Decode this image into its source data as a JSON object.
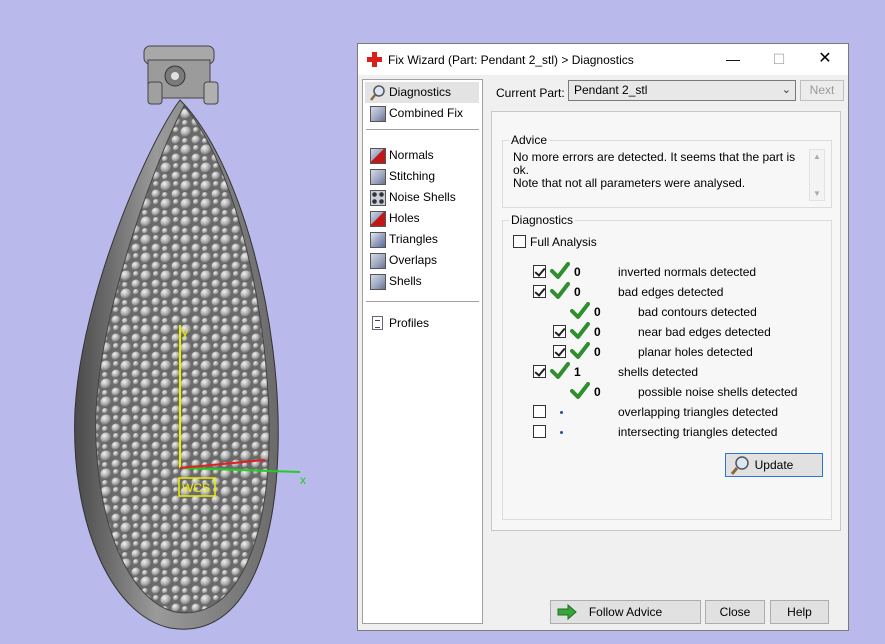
{
  "viewport": {
    "axis_y_label": "y",
    "axis_x_label": "x",
    "wcs_label": "WCS",
    "axis_x_color": "#22cc22",
    "axis_y_color": "#eeee00"
  },
  "dialog": {
    "title": "Fix Wizard (Part: Pendant 2_stl) > Diagnostics",
    "window_controls": {
      "minimize": "—",
      "maximize": "☐",
      "close": "✕"
    }
  },
  "nav": {
    "items": [
      {
        "label": "Diagnostics",
        "icon": "magnifier-icon",
        "selected": true
      },
      {
        "label": "Combined Fix",
        "icon": "cube-icon"
      },
      {
        "label": "Normals",
        "icon": "normals-cube-icon"
      },
      {
        "label": "Stitching",
        "icon": "stitching-cube-icon"
      },
      {
        "label": "Noise Shells",
        "icon": "noise-shells-icon"
      },
      {
        "label": "Holes",
        "icon": "holes-cube-icon"
      },
      {
        "label": "Triangles",
        "icon": "triangles-cube-icon"
      },
      {
        "label": "Overlaps",
        "icon": "overlaps-cube-icon"
      },
      {
        "label": "Shells",
        "icon": "shells-cube-icon"
      },
      {
        "label": "Profiles",
        "icon": "document-icon"
      }
    ]
  },
  "current_part": {
    "label": "Current Part:",
    "value": "Pendant 2_stl",
    "next_label": "Next"
  },
  "advice": {
    "title": "Advice",
    "line1": "No more errors are detected. It seems that the part is ok.",
    "line2": "Note that not all parameters were analysed."
  },
  "diagnostics": {
    "title": "Diagnostics",
    "full_analysis_label": "Full Analysis",
    "full_analysis_checked": false,
    "rows": [
      {
        "label": "inverted normals detected",
        "count": "0",
        "checked": true
      },
      {
        "label": "bad edges detected",
        "count": "0",
        "checked": true
      },
      {
        "label": "bad contours detected",
        "count": "0"
      },
      {
        "label": "near bad edges detected",
        "count": "0",
        "checked": true
      },
      {
        "label": "planar holes detected",
        "count": "0",
        "checked": true
      },
      {
        "label": "shells detected",
        "count": "1",
        "checked": true
      },
      {
        "label": "possible noise shells detected",
        "count": "0"
      },
      {
        "label": "overlapping triangles detected",
        "checked": false
      },
      {
        "label": "intersecting triangles detected",
        "checked": false
      }
    ],
    "update_label": "Update"
  },
  "footer": {
    "follow_advice": "Follow Advice",
    "close": "Close",
    "help": "Help"
  },
  "colors": {
    "background": "#b9b9ec",
    "check_green": "#2f8f2f",
    "dot_blue": "#234fb0"
  }
}
